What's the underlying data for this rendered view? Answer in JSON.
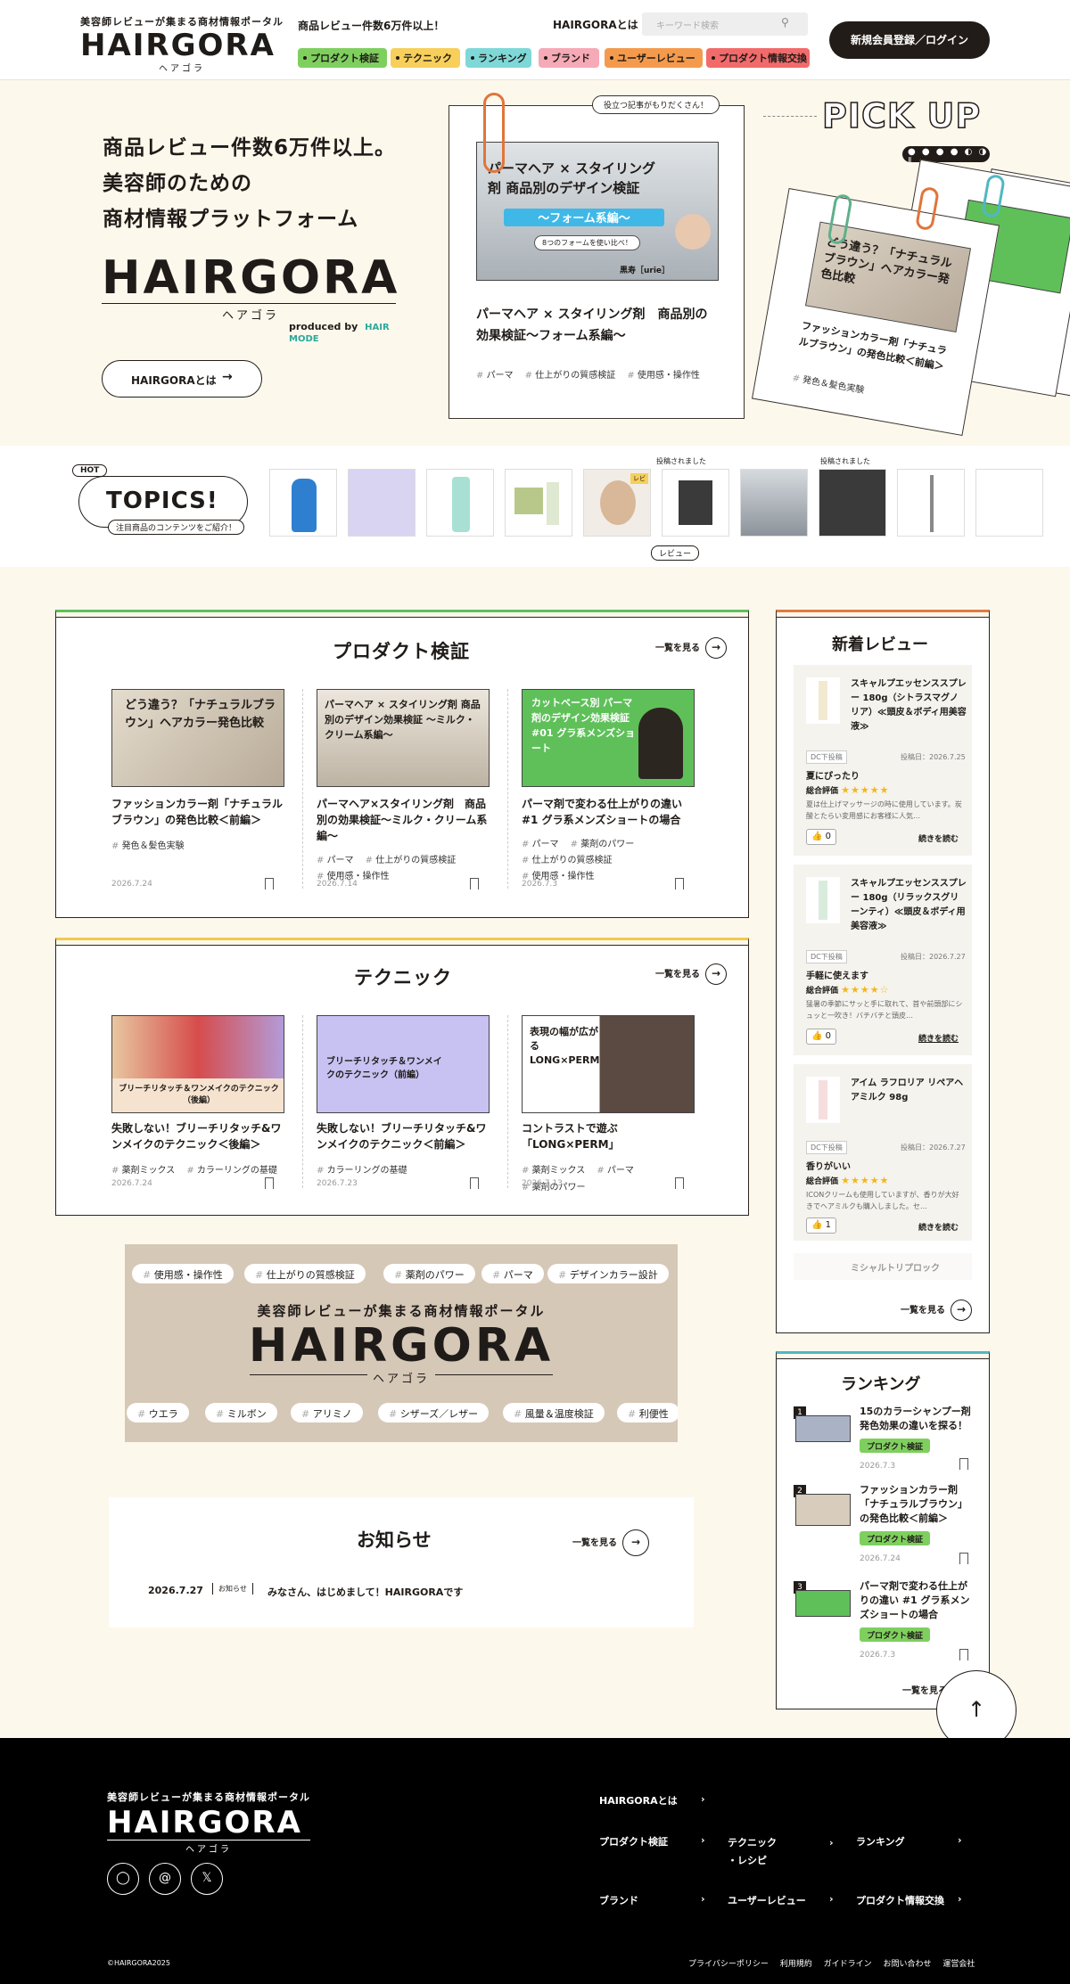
{
  "header": {
    "logo_tagline": "美容師レビューが集まる商材情報ポータル",
    "logo_word": "HAIRGORA",
    "logo_kana": "ヘアゴラ",
    "count_text": "商品レビュー件数6万件以上！",
    "about_link": "HAIRGORAとは",
    "search_placeholder": "キーワード検索",
    "login_button": "新規会員登録／ログイン",
    "nav": [
      {
        "label": "プロダクト検証",
        "color": "#7fcf5f"
      },
      {
        "label": "テクニック",
        "color": "#f7cf5a"
      },
      {
        "label": "ランキング",
        "color": "#7fd8d8"
      },
      {
        "label": "ブランド",
        "color": "#f6a9b6"
      },
      {
        "label": "ユーザーレビュー",
        "color": "#f49a4c"
      },
      {
        "label": "プロダクト情報交換",
        "color": "#f26b6b"
      }
    ]
  },
  "hero": {
    "line1": "商品レビュー件数6万件以上。",
    "line2": "美容師のための",
    "line3": "商材情報プラットフォーム",
    "logo_word": "HAIRGORA",
    "logo_kana": "ヘアゴラ",
    "produced_by": "produced by",
    "produced_brand": "HAIR MODE",
    "about_button": "HAIRGORAとは",
    "bubble": "役立つ記事がもりだくさん！",
    "feature_image_title": "パーマヘア × スタイリング剤 商品別のデザイン検証",
    "feature_image_sub": "〜フォーム系編〜",
    "feature_image_caption": "8つのフォームを使い比べ！",
    "feature_image_credit": "黒寿［urie］",
    "feature_title": "パーマヘア × スタイリング剤　商品別の効果検証〜フォーム系編〜",
    "feature_tags": [
      "パーマ",
      "仕上がりの質感検証",
      "使用感・操作性"
    ],
    "pickup": "PICK UP",
    "stack_image_title": "どう違う？「ナチュラルブラウン」ヘアカラー発色比較",
    "stack_title": "ファッションカラー剤「ナチュラルブラウン」の発色比較＜前編＞",
    "stack_tag": "発色＆髪色実験"
  },
  "topics": {
    "hot": "HOT",
    "title": "TOPICS!",
    "subtitle": "注目商品のコンテンツをご紹介！",
    "posted_label": "投稿されました",
    "review_label": "レビュー",
    "review_badge": "レビ"
  },
  "product_section": {
    "title": "プロダクト検証",
    "more": "一覧を見る",
    "items": [
      {
        "img_title": "どう違う？「ナチュラルブラウン」ヘアカラー発色比較",
        "title": "ファッションカラー剤「ナチュラルブラウン」の発色比較＜前編＞",
        "tags": [
          "発色＆髪色実験"
        ],
        "date": "2026.7.24"
      },
      {
        "img_title": "パーマヘア × スタイリング剤 商品別のデザイン効果検証 〜ミルク・クリーム系編〜",
        "title": "パーマヘア×スタイリング剤　商品別の効果検証〜ミルク・クリーム系編〜",
        "tags": [
          "パーマ",
          "仕上がりの質感検証",
          "使用感・操作性"
        ],
        "date": "2026.7.14"
      },
      {
        "img_title": "カットベース別 パーマ剤のデザイン効果検証 #01 グラ系メンズショート",
        "title": "パーマ剤で変わる仕上がりの違い #1 グラ系メンズショートの場合",
        "tags": [
          "パーマ",
          "薬剤のパワー",
          "仕上がりの質感検証",
          "使用感・操作性"
        ],
        "date": "2026.7.3"
      }
    ]
  },
  "technique_section": {
    "title": "テクニック",
    "more": "一覧を見る",
    "items": [
      {
        "img_title": "ブリーチリタッチ＆ワンメイクのテクニック（後編）",
        "title": "失敗しない！ブリーチリタッチ&ワンメイクのテクニック＜後編＞",
        "tags": [
          "薬剤ミックス",
          "カラーリングの基礎"
        ],
        "date": "2026.7.24"
      },
      {
        "img_title": "ブリーチリタッチ＆ワンメイクのテクニック（前編）",
        "title": "失敗しない！ブリーチリタッチ&ワンメイクのテクニック＜前編＞",
        "tags": [
          "カラーリングの基礎"
        ],
        "date": "2026.7.23"
      },
      {
        "img_title": "表現の幅が広がる LONG×PERM",
        "title": "コントラストで遊ぶ「LONG×PERM」",
        "tags": [
          "薬剤ミックス",
          "パーマ",
          "薬剤のパワー"
        ],
        "date": "2026.7.13"
      }
    ]
  },
  "banner": {
    "tagline": "美容師レビューが集まる商材情報ポータル",
    "word": "HAIRGORA",
    "kana": "ヘアゴラ",
    "chips_top": [
      "使用感・操作性",
      "仕上がりの質感検証",
      "薬剤のパワー",
      "パーマ",
      "デザインカラー設計"
    ],
    "chips_bottom": [
      "ウエラ",
      "ミルボン",
      "アリミノ",
      "シザーズ／レザー",
      "風量＆温度検証",
      "利便性"
    ]
  },
  "news": {
    "title": "お知らせ",
    "more": "一覧を見る",
    "date": "2026.7.27",
    "category": "お知らせ",
    "text": "みなさん、はじめまして！HAIRGORAです"
  },
  "reviews": {
    "title": "新着レビュー",
    "more": "一覧を見る",
    "items": [
      {
        "name": "スキャルプエッセンススプレー 180g（シトラスマグノリア）≪頭皮＆ボディ用美容液≫",
        "status": "DC下投稿",
        "date": "投稿日：2026.7.25",
        "heading": "夏にぴったり",
        "rating_label": "総合評価",
        "stars": "★★★★★",
        "body": "夏は仕上げマッサージの時に使用しています。炭酸とたらい変用感にお客様に人気…",
        "likes": "0",
        "read": "続きを読む"
      },
      {
        "name": "スキャルプエッセンススプレー 180g（リラックスグリーンティ）≪頭皮＆ボディ用美容液≫",
        "status": "DC下投稿",
        "date": "投稿日：2026.7.27",
        "heading": "手軽に使えます",
        "rating_label": "総合評価",
        "stars": "★★★★☆",
        "body": "猛暑の季節にサッと手に取れて、首や前頭部にシュッと一吹き！バチバチと頭皮…",
        "likes": "0",
        "read": "続きを読む"
      },
      {
        "name": "アイム ラフロリア リペアヘアミルク 98g",
        "status": "DC下投稿",
        "date": "投稿日：2026.7.27",
        "heading": "香りがいい",
        "rating_label": "総合評価",
        "stars": "★★★★★",
        "body": "ICONクリームも使用していますが、香りが大好きでヘアミルクも購入しました。セ…",
        "likes": "1",
        "read": "続きを読む"
      }
    ],
    "faded_item": "ミシャルトリプロック"
  },
  "ranking": {
    "title": "ランキング",
    "more": "一覧を見る",
    "items": [
      {
        "rank": "1",
        "title": "15のカラーシャンプー剤 発色効果の違いを探る！",
        "tag": "プロダクト検証",
        "date": "2026.7.3"
      },
      {
        "rank": "2",
        "title": "ファッションカラー剤「ナチュラルブラウン」の発色比較＜前編＞",
        "tag": "プロダクト検証",
        "date": "2026.7.24"
      },
      {
        "rank": "3",
        "title": "パーマ剤で変わる仕上がりの違い #1 グラ系メンズショートの場合",
        "tag": "プロダクト検証",
        "date": "2026.7.3"
      }
    ]
  },
  "footer": {
    "tagline": "美容師レビューが集まる商材情報ポータル",
    "word": "HAIRGORA",
    "kana": "ヘアゴラ",
    "links": {
      "about": "HAIRGORAとは",
      "product": "プロダクト検証",
      "technique": "テクニック",
      "recipe": "・レシピ",
      "ranking": "ランキング",
      "brand": "ブランド",
      "user_review": "ユーザーレビュー",
      "exchange": "プロダクト情報交換"
    },
    "copyright": "©HAIRGORA2025",
    "legal": [
      "プライバシーポリシー",
      "利用規約",
      "ガイドライン",
      "お問い合わせ",
      "運営会社"
    ]
  },
  "colors": {
    "accent_green": "#7fcf5f",
    "dark": "#221c18",
    "cream": "#fdf8ec"
  }
}
